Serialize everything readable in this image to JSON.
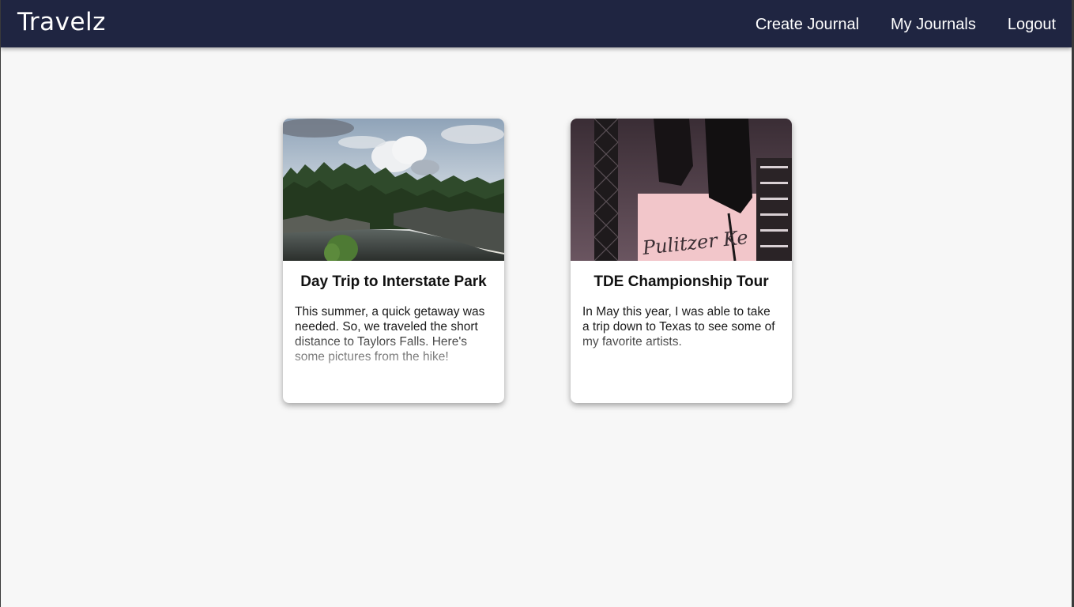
{
  "navbar": {
    "brand": "Travelz",
    "links": [
      {
        "label": "Create Journal"
      },
      {
        "label": "My Journals"
      },
      {
        "label": "Logout"
      }
    ]
  },
  "journals": [
    {
      "title": "Day Trip to Interstate Park",
      "description": "This summer, a quick getaway was needed. So, we traveled the short distance to Taylors Falls. Here's some pictures from the hike!",
      "image_icon": "landscape-photo"
    },
    {
      "title": "TDE Championship Tour",
      "description": "In May this year, I was able to take a trip down to Texas to see some of my favorite artists.",
      "image_icon": "concert-photo",
      "image_sign_text": "Pulitzer Ke"
    }
  ],
  "colors": {
    "navbar": "#1f2541",
    "background": "#f7f7f7",
    "card": "#ffffff"
  }
}
